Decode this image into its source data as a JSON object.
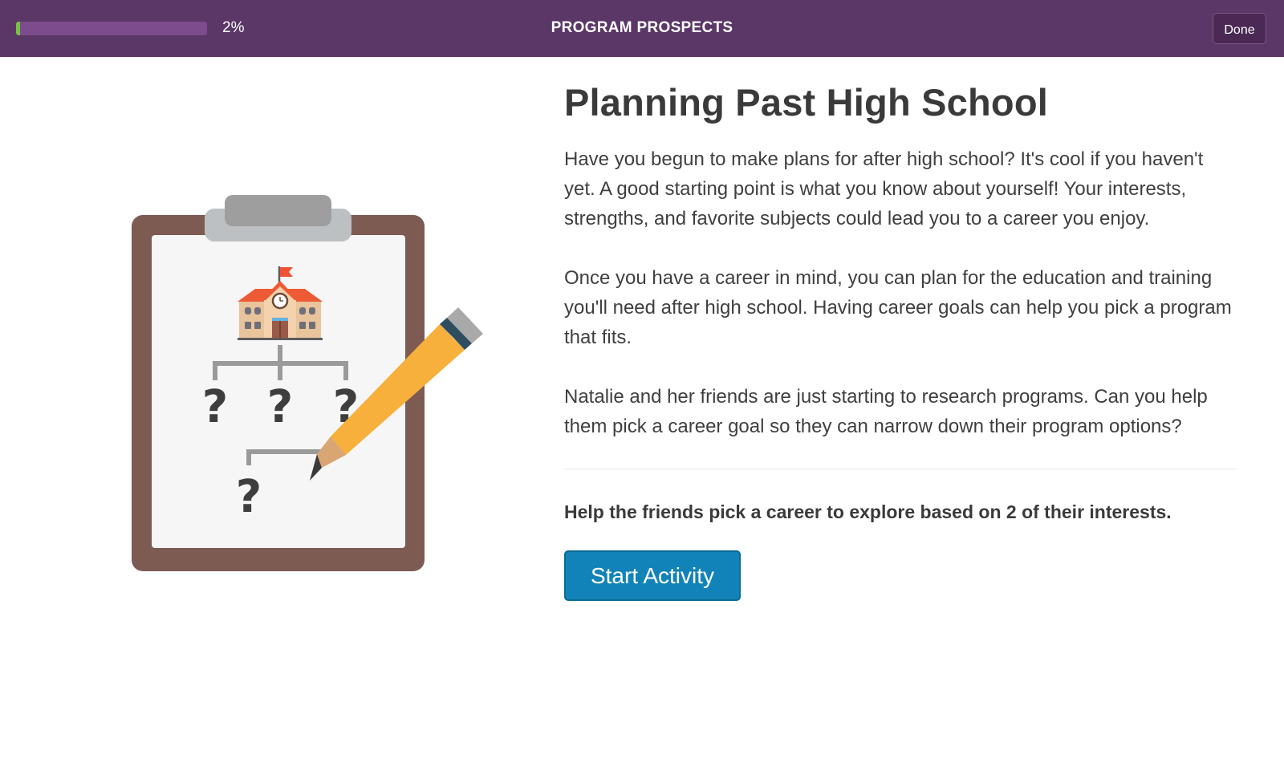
{
  "header": {
    "progress_value": 2,
    "progress_label": "2%",
    "title": "PROGRAM PROSPECTS",
    "done_label": "Done"
  },
  "illustration": {
    "question_mark": "?"
  },
  "main": {
    "title": "Planning Past High School",
    "paragraphs": [
      "Have you begun to make plans for after high school? It's cool if you haven't yet. A good starting point is what you know about yourself! Your interests, strengths, and favorite subjects could lead you to a career you enjoy.",
      "Once you have a career in mind, you can plan for the education and training you'll need after high school. Having career goals can help you pick a program that fits.",
      "Natalie and her friends are just starting to research programs. Can you help them pick a career goal so they can narrow down their program options?"
    ],
    "instruction": "Help the friends pick a career to explore based on 2 of their interests.",
    "start_label": "Start Activity"
  },
  "colors": {
    "header_bg": "#5a3766",
    "progress_track": "#7c4c8c",
    "progress_fill": "#77c043",
    "primary_button": "#1283b8",
    "clipboard_frame": "#7d5a52",
    "pencil": "#f6b03b"
  }
}
